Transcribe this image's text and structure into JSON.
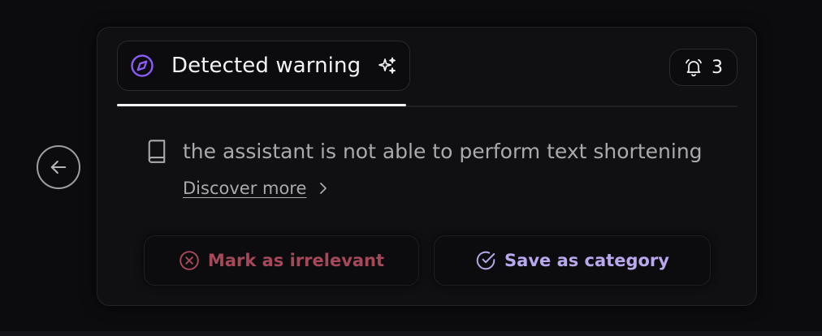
{
  "tab": {
    "title": "Detected warning",
    "icon": "compass-icon",
    "accent_color": "#8b5cf6"
  },
  "notifications": {
    "icon": "bell-icon",
    "count": "3"
  },
  "warning": {
    "icon": "book-icon",
    "message": "the assistant is not able to perform text shortening",
    "link_label": "Discover more"
  },
  "actions": {
    "irrelevant": {
      "label": "Mark as irrelevant",
      "icon": "x-circle-icon",
      "color": "#a5485a"
    },
    "save": {
      "label": "Save as category",
      "icon": "check-circle-icon",
      "color": "#b9a8ee"
    }
  },
  "navigation": {
    "back_icon": "arrow-left-icon"
  }
}
